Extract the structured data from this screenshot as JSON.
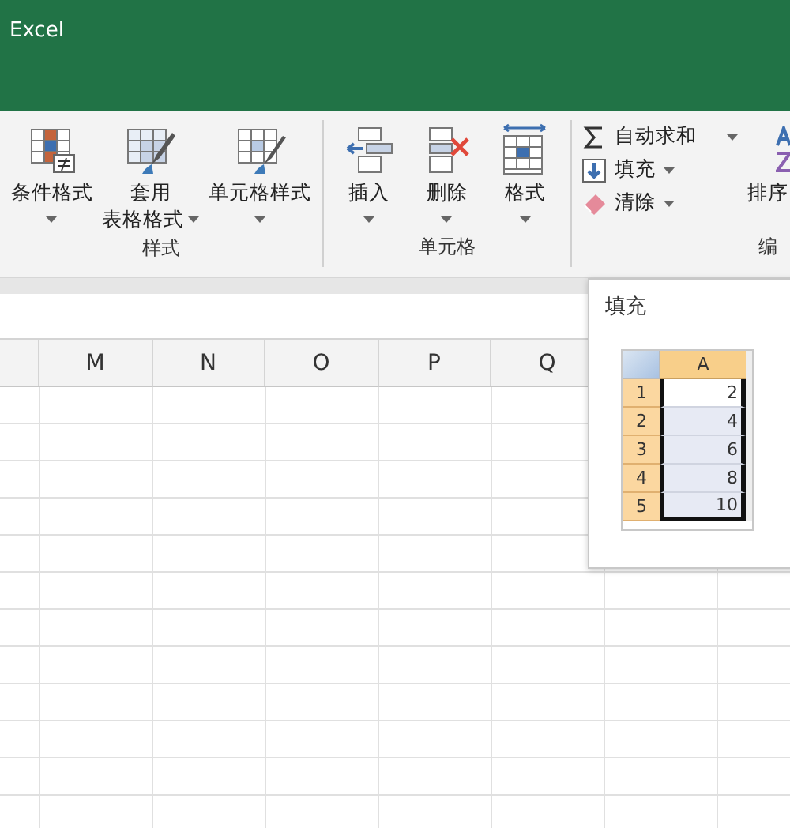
{
  "window": {
    "title": "Excel"
  },
  "ribbon": {
    "groups": [
      {
        "label": "样式",
        "commands": [
          {
            "lines": [
              "条件格式"
            ],
            "dropdown": true
          },
          {
            "lines": [
              "套用",
              "表格格式"
            ],
            "dropdown": true
          },
          {
            "lines": [
              "单元格样式"
            ],
            "dropdown": true
          }
        ]
      },
      {
        "label": "单元格",
        "commands": [
          {
            "lines": [
              "插入"
            ],
            "dropdown": true
          },
          {
            "lines": [
              "删除"
            ],
            "dropdown": true
          },
          {
            "lines": [
              "格式"
            ],
            "dropdown": true
          }
        ]
      },
      {
        "label": "编",
        "small_commands": [
          {
            "label": "自动求和",
            "dropdown": true
          },
          {
            "label": "填充",
            "dropdown": true
          },
          {
            "label": "清除",
            "dropdown": true
          }
        ],
        "commands": [
          {
            "lines": [
              "排序"
            ],
            "dropdown": false
          }
        ]
      }
    ]
  },
  "sheet": {
    "columns": [
      "",
      "M",
      "N",
      "O",
      "P",
      "Q"
    ]
  },
  "tooltip": {
    "title": "填充",
    "preview": {
      "column": "A",
      "rows": [
        {
          "row": "1",
          "value": "2"
        },
        {
          "row": "2",
          "value": "4"
        },
        {
          "row": "3",
          "value": "6"
        },
        {
          "row": "4",
          "value": "8"
        },
        {
          "row": "5",
          "value": "10"
        }
      ]
    }
  }
}
